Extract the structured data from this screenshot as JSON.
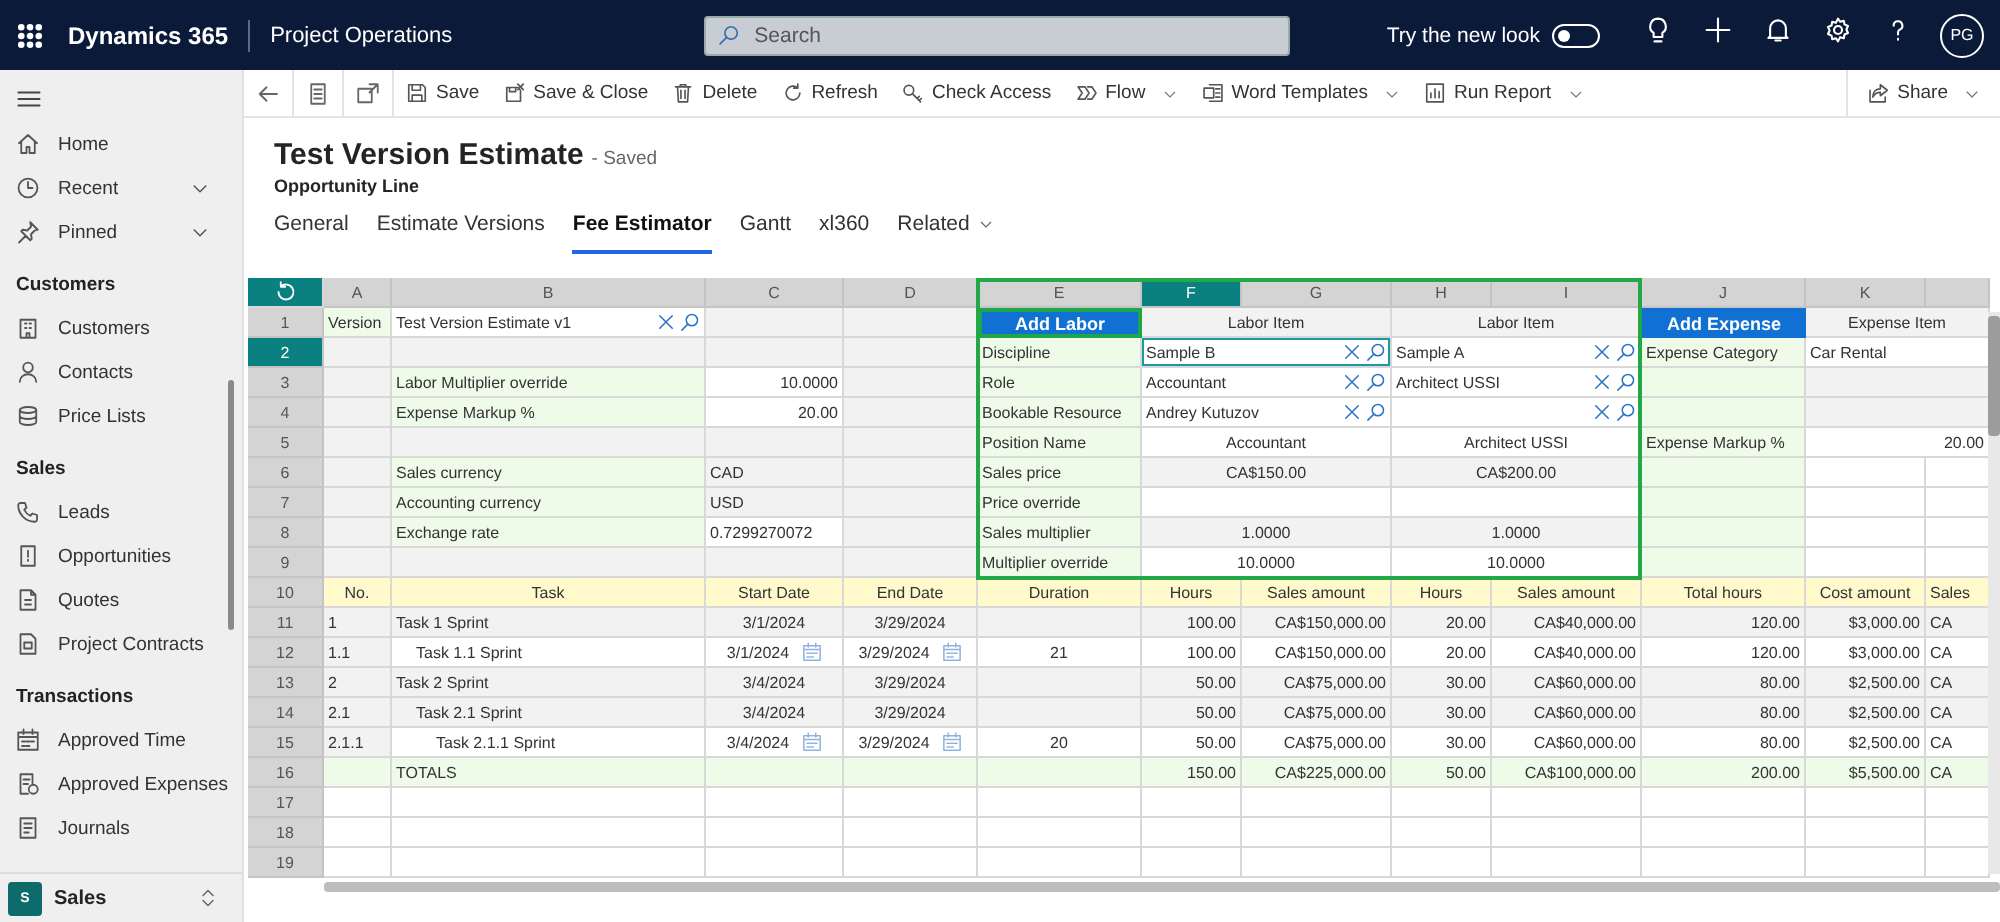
{
  "top_bar": {
    "app_name": "Dynamics 365",
    "area": "Project Operations",
    "search": {
      "placeholder": "Search"
    },
    "new_look": {
      "label": "Try the new look",
      "on": false
    },
    "avatar": "PG"
  },
  "sidebar": {
    "top_items": [
      {
        "label": "Home"
      },
      {
        "label": "Recent",
        "expanded": false
      },
      {
        "label": "Pinned",
        "expanded": false
      }
    ],
    "groups": [
      {
        "title": "Customers",
        "items": [
          {
            "label": "Customers"
          },
          {
            "label": "Contacts"
          },
          {
            "label": "Price Lists"
          }
        ]
      },
      {
        "title": "Sales",
        "items": [
          {
            "label": "Leads"
          },
          {
            "label": "Opportunities"
          },
          {
            "label": "Quotes"
          },
          {
            "label": "Project Contracts"
          }
        ]
      },
      {
        "title": "Transactions",
        "items": [
          {
            "label": "Approved Time"
          },
          {
            "label": "Approved Expenses"
          },
          {
            "label": "Journals"
          }
        ]
      }
    ],
    "area": {
      "badge": "S",
      "label": "Sales"
    }
  },
  "command_bar": {
    "buttons": [
      {
        "label": "Save"
      },
      {
        "label": "Save & Close"
      },
      {
        "label": "Delete"
      },
      {
        "label": "Refresh"
      },
      {
        "label": "Check Access"
      },
      {
        "label": "Flow",
        "menu": true
      },
      {
        "label": "Word Templates",
        "menu": true
      },
      {
        "label": "Run Report",
        "menu": true
      }
    ],
    "share": {
      "label": "Share"
    }
  },
  "record": {
    "title": "Test Version Estimate",
    "status": "- Saved",
    "entity": "Opportunity Line"
  },
  "tabs": [
    {
      "label": "General",
      "selected": false
    },
    {
      "label": "Estimate Versions",
      "selected": false
    },
    {
      "label": "Fee Estimator",
      "selected": true
    },
    {
      "label": "Gantt",
      "selected": false
    },
    {
      "label": "xl360",
      "selected": false
    },
    {
      "label": "Related",
      "selected": false,
      "menu": true
    }
  ],
  "sheet": {
    "labor_block_outlined": true,
    "columns": [
      {
        "letter": "A",
        "selected": false
      },
      {
        "letter": "B",
        "selected": false
      },
      {
        "letter": "C",
        "selected": false
      },
      {
        "letter": "D",
        "selected": false
      },
      {
        "letter": "E",
        "selected": false
      },
      {
        "letter": "F",
        "selected": true
      },
      {
        "letter": "G",
        "selected": false
      },
      {
        "letter": "H",
        "selected": false
      },
      {
        "letter": "I",
        "selected": false
      },
      {
        "letter": "J",
        "selected": false
      },
      {
        "letter": "K",
        "selected": false
      },
      {
        "selected": false
      }
    ],
    "rows": [
      {
        "number": "1",
        "selected": false,
        "kind": "data",
        "cells": [
          {
            "kind": "label",
            "text": "Version"
          },
          {
            "kind": "lookup",
            "text": "Test Version Estimate v1"
          },
          {
            "kind": "text",
            "locked": true
          },
          {
            "kind": "text",
            "locked": true
          },
          {
            "kind": "button",
            "text": "Add Labor",
            "outlined": true
          },
          {
            "kind": "centered",
            "locked": true,
            "text": "Labor Item"
          },
          {
            "kind": "centered",
            "locked": true,
            "text": "Labor Item"
          },
          {
            "kind": "button",
            "text": "Add Expense",
            "outlined": false
          },
          {
            "kind": "centered",
            "locked": true,
            "text": "Expense Item"
          }
        ]
      },
      {
        "number": "2",
        "selected": true,
        "kind": "data",
        "cells": [
          {
            "kind": "text",
            "locked": true
          },
          {
            "kind": "text",
            "locked": true
          },
          {
            "kind": "text",
            "locked": true
          },
          {
            "kind": "text",
            "locked": true
          },
          {
            "kind": "label",
            "text": "Discipline"
          },
          {
            "kind": "lookup",
            "text": "Sample B",
            "active": true
          },
          {
            "kind": "lookup",
            "text": "Sample A"
          },
          {
            "kind": "label",
            "text": "Expense Category"
          },
          {
            "kind": "text",
            "text": "Car Rental"
          }
        ]
      },
      {
        "number": "3",
        "selected": false,
        "kind": "data",
        "cells": [
          {
            "kind": "text",
            "locked": true
          },
          {
            "kind": "label",
            "text": "Labor Multiplier override"
          },
          {
            "kind": "number",
            "text": "10.0000"
          },
          {
            "kind": "text",
            "locked": true
          },
          {
            "kind": "label",
            "text": "Role"
          },
          {
            "kind": "lookup",
            "text": "Accountant"
          },
          {
            "kind": "lookup",
            "text": "Architect USSI"
          },
          {
            "kind": "label"
          },
          {
            "kind": "text",
            "locked": true
          }
        ]
      },
      {
        "number": "4",
        "selected": false,
        "kind": "data",
        "cells": [
          {
            "kind": "text",
            "locked": true
          },
          {
            "kind": "label",
            "text": "Expense Markup %"
          },
          {
            "kind": "number",
            "text": "20.00"
          },
          {
            "kind": "text",
            "locked": true
          },
          {
            "kind": "label",
            "text": "Bookable Resource"
          },
          {
            "kind": "lookup",
            "text": "Andrey Kutuzov"
          },
          {
            "kind": "lookup"
          },
          {
            "kind": "label"
          },
          {
            "kind": "text",
            "locked": true
          }
        ]
      },
      {
        "number": "5",
        "selected": false,
        "kind": "data",
        "cells": [
          {
            "kind": "text",
            "locked": true
          },
          {
            "kind": "text",
            "locked": true
          },
          {
            "kind": "text",
            "locked": true
          },
          {
            "kind": "text",
            "locked": true
          },
          {
            "kind": "label",
            "text": "Position Name"
          },
          {
            "kind": "centered",
            "text": "Accountant"
          },
          {
            "kind": "centered",
            "text": "Architect USSI"
          },
          {
            "kind": "label",
            "text": "Expense Markup %"
          },
          {
            "kind": "number",
            "text": "20.00"
          }
        ]
      },
      {
        "number": "6",
        "selected": false,
        "kind": "data",
        "cells": [
          {
            "kind": "text",
            "locked": true
          },
          {
            "kind": "label",
            "text": "Sales currency"
          },
          {
            "kind": "text",
            "locked": true,
            "text": "CAD"
          },
          {
            "kind": "text",
            "locked": true
          },
          {
            "kind": "label",
            "text": "Sales price"
          },
          {
            "kind": "centered",
            "locked": true,
            "text": "CA$150.00"
          },
          {
            "kind": "centered",
            "locked": true,
            "text": "CA$200.00"
          },
          {
            "kind": "label"
          },
          {
            "kind": "text"
          },
          {
            "kind": "text"
          }
        ]
      },
      {
        "number": "7",
        "selected": false,
        "kind": "data",
        "cells": [
          {
            "kind": "text",
            "locked": true
          },
          {
            "kind": "label",
            "text": "Accounting currency"
          },
          {
            "kind": "text",
            "locked": true,
            "text": "USD"
          },
          {
            "kind": "text",
            "locked": true
          },
          {
            "kind": "label",
            "text": "Price override"
          },
          {
            "kind": "text"
          },
          {
            "kind": "text"
          },
          {
            "kind": "label"
          },
          {
            "kind": "text"
          },
          {
            "kind": "text"
          }
        ]
      },
      {
        "number": "8",
        "selected": false,
        "kind": "data",
        "cells": [
          {
            "kind": "text",
            "locked": true
          },
          {
            "kind": "label",
            "text": "Exchange rate"
          },
          {
            "kind": "text",
            "text": "0.7299270072"
          },
          {
            "kind": "text",
            "locked": true
          },
          {
            "kind": "label",
            "text": "Sales multiplier"
          },
          {
            "kind": "centered",
            "locked": true,
            "text": "1.0000"
          },
          {
            "kind": "centered",
            "locked": true,
            "text": "1.0000"
          },
          {
            "kind": "label"
          },
          {
            "kind": "text"
          },
          {
            "kind": "text"
          }
        ]
      },
      {
        "number": "9",
        "selected": false,
        "kind": "data",
        "cells": [
          {
            "kind": "text",
            "locked": true
          },
          {
            "kind": "text",
            "locked": true
          },
          {
            "kind": "text",
            "locked": true
          },
          {
            "kind": "text",
            "locked": true
          },
          {
            "kind": "label",
            "text": "Multiplier override"
          },
          {
            "kind": "centered",
            "text": "10.0000"
          },
          {
            "kind": "centered",
            "text": "10.0000"
          },
          {
            "kind": "label"
          },
          {
            "kind": "text"
          },
          {
            "kind": "text"
          }
        ]
      },
      {
        "number": "10",
        "selected": false,
        "kind": "heading",
        "cells": [
          {
            "kind": "centered",
            "text": "No."
          },
          {
            "kind": "centered",
            "text": "Task"
          },
          {
            "kind": "centered",
            "text": "Start Date"
          },
          {
            "kind": "centered",
            "text": "End Date"
          },
          {
            "kind": "centered",
            "text": "Duration"
          },
          {
            "kind": "centered",
            "text": "Hours"
          },
          {
            "kind": "centered",
            "text": "Sales amount"
          },
          {
            "kind": "centered",
            "text": "Hours"
          },
          {
            "kind": "centered",
            "text": "Sales amount"
          },
          {
            "kind": "centered",
            "text": "Total hours"
          },
          {
            "kind": "centered",
            "text": "Cost amount"
          },
          {
            "kind": "text",
            "text": "Sales"
          }
        ]
      },
      {
        "number": "11",
        "selected": false,
        "kind": "data",
        "cells": [
          {
            "kind": "text",
            "locked": true,
            "text": "1"
          },
          {
            "kind": "text",
            "locked": true,
            "text": "Task 1 Sprint"
          },
          {
            "kind": "centered",
            "locked": true,
            "text": "3/1/2024"
          },
          {
            "kind": "centered",
            "locked": true,
            "text": "3/29/2024"
          },
          {
            "kind": "text",
            "locked": true
          },
          {
            "kind": "number",
            "locked": true,
            "text": "100.00"
          },
          {
            "kind": "number",
            "locked": true,
            "text": "CA$150,000.00"
          },
          {
            "kind": "number",
            "locked": true,
            "text": "20.00"
          },
          {
            "kind": "number",
            "locked": true,
            "text": "CA$40,000.00"
          },
          {
            "kind": "number",
            "locked": true,
            "text": "120.00"
          },
          {
            "kind": "number",
            "locked": true,
            "text": "$3,000.00"
          },
          {
            "kind": "text",
            "locked": true,
            "text": "CA"
          }
        ]
      },
      {
        "number": "12",
        "selected": false,
        "kind": "data",
        "cells": [
          {
            "kind": "text",
            "locked": true,
            "text": "1.1"
          },
          {
            "kind": "child",
            "text": "Task 1.1 Sprint"
          },
          {
            "kind": "date",
            "text": "3/1/2024"
          },
          {
            "kind": "date",
            "text": "3/29/2024"
          },
          {
            "kind": "centered",
            "text": "21"
          },
          {
            "kind": "number",
            "text": "100.00"
          },
          {
            "kind": "number",
            "text": "CA$150,000.00"
          },
          {
            "kind": "number",
            "text": "20.00"
          },
          {
            "kind": "number",
            "text": "CA$40,000.00"
          },
          {
            "kind": "number",
            "text": "120.00"
          },
          {
            "kind": "number",
            "text": "$3,000.00"
          },
          {
            "kind": "text",
            "text": "CA"
          }
        ]
      },
      {
        "number": "13",
        "selected": false,
        "kind": "data",
        "cells": [
          {
            "kind": "text",
            "locked": true,
            "text": "2"
          },
          {
            "kind": "text",
            "locked": true,
            "text": "Task 2 Sprint"
          },
          {
            "kind": "centered",
            "locked": true,
            "text": "3/4/2024"
          },
          {
            "kind": "centered",
            "locked": true,
            "text": "3/29/2024"
          },
          {
            "kind": "text",
            "locked": true
          },
          {
            "kind": "number",
            "locked": true,
            "text": "50.00"
          },
          {
            "kind": "number",
            "locked": true,
            "text": "CA$75,000.00"
          },
          {
            "kind": "number",
            "locked": true,
            "text": "30.00"
          },
          {
            "kind": "number",
            "locked": true,
            "text": "CA$60,000.00"
          },
          {
            "kind": "number",
            "locked": true,
            "text": "80.00"
          },
          {
            "kind": "number",
            "locked": true,
            "text": "$2,500.00"
          },
          {
            "kind": "text",
            "locked": true,
            "text": "CA"
          }
        ]
      },
      {
        "number": "14",
        "selected": false,
        "kind": "data",
        "cells": [
          {
            "kind": "text",
            "locked": true,
            "text": "2.1"
          },
          {
            "kind": "child",
            "locked": true,
            "text": "Task 2.1 Sprint"
          },
          {
            "kind": "centered",
            "locked": true,
            "text": "3/4/2024"
          },
          {
            "kind": "centered",
            "locked": true,
            "text": "3/29/2024"
          },
          {
            "kind": "text",
            "locked": true
          },
          {
            "kind": "number",
            "locked": true,
            "text": "50.00"
          },
          {
            "kind": "number",
            "locked": true,
            "text": "CA$75,000.00"
          },
          {
            "kind": "number",
            "locked": true,
            "text": "30.00"
          },
          {
            "kind": "number",
            "locked": true,
            "text": "CA$60,000.00"
          },
          {
            "kind": "number",
            "locked": true,
            "text": "80.00"
          },
          {
            "kind": "number",
            "locked": true,
            "text": "$2,500.00"
          },
          {
            "kind": "text",
            "locked": true,
            "text": "CA"
          }
        ]
      },
      {
        "number": "15",
        "selected": false,
        "kind": "data",
        "cells": [
          {
            "kind": "text",
            "locked": true,
            "text": "2.1.1"
          },
          {
            "kind": "grandchild",
            "text": "Task 2.1.1 Sprint"
          },
          {
            "kind": "date",
            "text": "3/4/2024"
          },
          {
            "kind": "date",
            "text": "3/29/2024"
          },
          {
            "kind": "centered",
            "text": "20"
          },
          {
            "kind": "number",
            "text": "50.00"
          },
          {
            "kind": "number",
            "text": "CA$75,000.00"
          },
          {
            "kind": "number",
            "text": "30.00"
          },
          {
            "kind": "number",
            "text": "CA$60,000.00"
          },
          {
            "kind": "number",
            "text": "80.00"
          },
          {
            "kind": "number",
            "text": "$2,500.00"
          },
          {
            "kind": "text",
            "text": "CA"
          }
        ]
      },
      {
        "number": "16",
        "selected": false,
        "kind": "totals",
        "cells": [
          {
            "kind": "text"
          },
          {
            "kind": "text",
            "text": "TOTALS"
          },
          {
            "kind": "text"
          },
          {
            "kind": "text"
          },
          {
            "kind": "text"
          },
          {
            "kind": "number",
            "text": "150.00"
          },
          {
            "kind": "number",
            "text": "CA$225,000.00"
          },
          {
            "kind": "number",
            "text": "50.00"
          },
          {
            "kind": "number",
            "text": "CA$100,000.00"
          },
          {
            "kind": "number",
            "text": "200.00"
          },
          {
            "kind": "number",
            "text": "$5,500.00"
          },
          {
            "kind": "text",
            "text": "CA"
          }
        ]
      },
      {
        "number": "17",
        "selected": false,
        "kind": "data",
        "cells": [
          {
            "kind": "text"
          },
          {
            "kind": "text"
          },
          {
            "kind": "text"
          },
          {
            "kind": "text"
          },
          {
            "kind": "text"
          },
          {
            "kind": "text"
          },
          {
            "kind": "text"
          },
          {
            "kind": "text"
          },
          {
            "kind": "text"
          },
          {
            "kind": "text"
          },
          {
            "kind": "text"
          },
          {
            "kind": "text"
          }
        ]
      },
      {
        "number": "18",
        "selected": false,
        "kind": "data",
        "cells": [
          {
            "kind": "text"
          },
          {
            "kind": "text"
          },
          {
            "kind": "text"
          },
          {
            "kind": "text"
          },
          {
            "kind": "text"
          },
          {
            "kind": "text"
          },
          {
            "kind": "text"
          },
          {
            "kind": "text"
          },
          {
            "kind": "text"
          },
          {
            "kind": "text"
          },
          {
            "kind": "text"
          },
          {
            "kind": "text"
          }
        ]
      },
      {
        "number": "19",
        "selected": false,
        "kind": "data",
        "cells": [
          {
            "kind": "text"
          },
          {
            "kind": "text"
          },
          {
            "kind": "text"
          },
          {
            "kind": "text"
          },
          {
            "kind": "text"
          },
          {
            "kind": "text"
          },
          {
            "kind": "text"
          },
          {
            "kind": "text"
          },
          {
            "kind": "text"
          },
          {
            "kind": "text"
          },
          {
            "kind": "text"
          },
          {
            "kind": "text"
          }
        ]
      }
    ]
  }
}
